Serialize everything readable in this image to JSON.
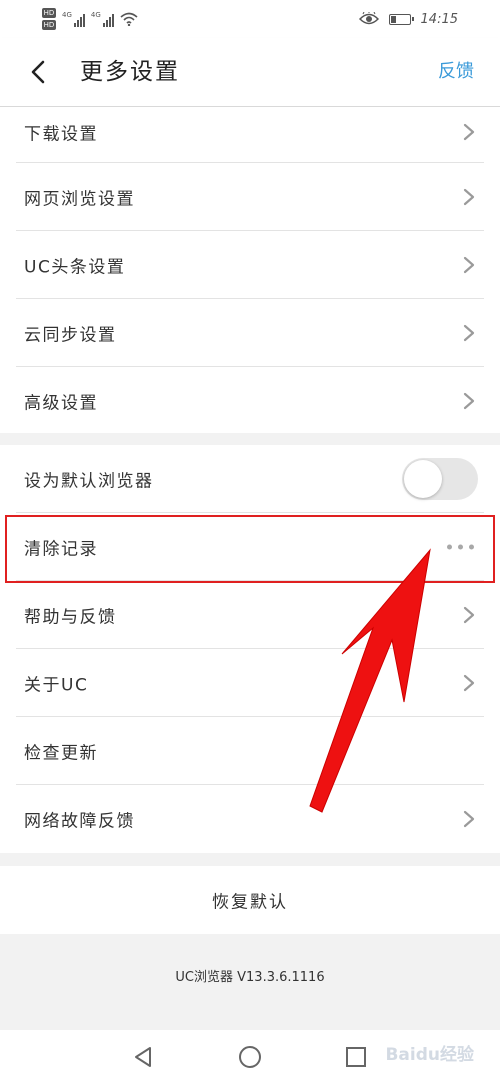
{
  "status_bar": {
    "sim1": "HD",
    "sim2": "HD",
    "net1": "4G",
    "net2": "4G",
    "time": "14:15",
    "battery_level": 0.35
  },
  "header": {
    "title": "更多设置",
    "feedback_label": "反馈"
  },
  "group1": {
    "items": [
      {
        "label": "下载设置"
      },
      {
        "label": "网页浏览设置"
      },
      {
        "label": "UC头条设置"
      },
      {
        "label": "云同步设置"
      },
      {
        "label": "高级设置"
      }
    ]
  },
  "group2": {
    "items": [
      {
        "label": "设为默认浏览器",
        "toggle_on": false
      },
      {
        "label": "清除记录"
      },
      {
        "label": "帮助与反馈"
      },
      {
        "label": "关于UC"
      },
      {
        "label": "检查更新"
      },
      {
        "label": "网络故障反馈"
      }
    ]
  },
  "restore": {
    "label": "恢复默认"
  },
  "footer": {
    "version": "UC浏览器 V13.3.6.1116"
  },
  "watermark": "Baidu经验",
  "colors": {
    "accent": "#3a9ad9",
    "highlight": "#e02020",
    "arrow": "#ee1111"
  }
}
